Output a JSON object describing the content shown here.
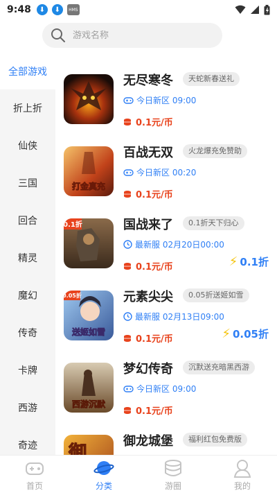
{
  "status": {
    "time": "9:48",
    "badge": "HMS"
  },
  "search": {
    "placeholder": "游戏名称"
  },
  "sidebar": {
    "items": [
      {
        "label": "全部游戏"
      },
      {
        "label": "折上折"
      },
      {
        "label": "仙侠"
      },
      {
        "label": "三国"
      },
      {
        "label": "回合"
      },
      {
        "label": "精灵"
      },
      {
        "label": "魔幻"
      },
      {
        "label": "传奇"
      },
      {
        "label": "卡牌"
      },
      {
        "label": "西游"
      },
      {
        "label": "奇迹"
      }
    ]
  },
  "games": [
    {
      "name": "无尽寒冬",
      "tag": "天蛇新春送礼",
      "info": "今日新区 09:00",
      "info_icon": "gamepad-icon",
      "price": "0.1元/币",
      "discount": ""
    },
    {
      "name": "百战无双",
      "tag": "火龙爆充免赞助",
      "info": "今日新区 00:20",
      "info_icon": "gamepad-icon",
      "price": "0.1元/币",
      "discount": "",
      "thumb_text": "打金真充"
    },
    {
      "name": "国战来了",
      "tag": "0.1折天下归心",
      "info": "最新服 02月20日00:00",
      "info_icon": "clock-icon",
      "price": "0.1元/币",
      "discount": "0.1折",
      "thumb_text": "0.1折"
    },
    {
      "name": "元素尖尖",
      "tag": "0.05折送姬如雪",
      "info": "最新服 02月13日09:00",
      "info_icon": "clock-icon",
      "price": "0.1元/币",
      "discount": "0.05折",
      "thumb_text": "送姬如雪",
      "thumb_corner": "0.05折"
    },
    {
      "name": "梦幻传奇",
      "tag": "沉默送充暗黑西游",
      "info": "今日新区 09:00",
      "info_icon": "gamepad-icon",
      "price": "0.1元/币",
      "discount": "",
      "thumb_text": "西游沉默"
    },
    {
      "name": "御龙城堡",
      "tag": "福利红包免费版",
      "info": "",
      "price": "",
      "discount": "",
      "thumb_text": "御"
    }
  ],
  "tabs": [
    {
      "label": "首页",
      "icon": "gamepad-icon"
    },
    {
      "label": "分类",
      "icon": "planet-icon",
      "active": true
    },
    {
      "label": "游圈",
      "icon": "stack-icon"
    },
    {
      "label": "我的",
      "icon": "user-icon"
    }
  ],
  "colors": {
    "accent": "#2f7ff5",
    "price": "#e8431d",
    "bolt": "#f5c40e"
  }
}
